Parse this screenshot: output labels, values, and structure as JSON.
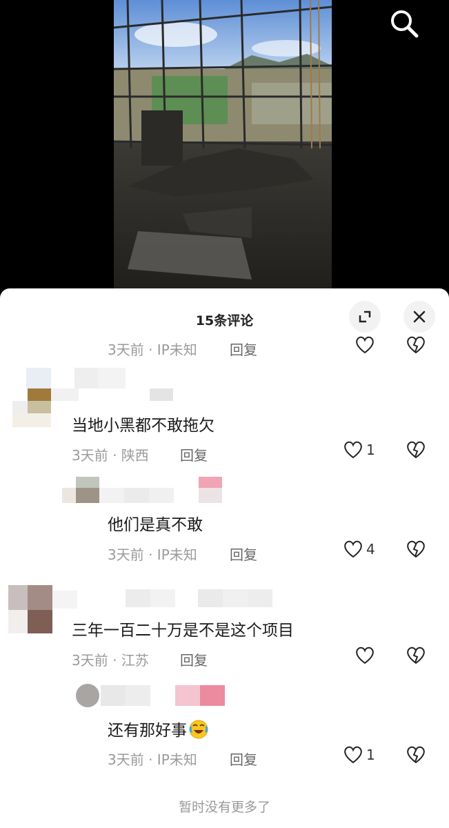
{
  "sheet": {
    "title": "15条评论",
    "footer": "暂时没有更多了"
  },
  "comments": [
    {
      "meta": "3天前 · IP未知",
      "reply": "回复",
      "likes": ""
    },
    {
      "text": "当地小黑都不敢拖欠",
      "meta": "3天前 · 陕西",
      "reply": "回复",
      "likes": "1"
    },
    {
      "text": "他们是真不敢",
      "meta": "3天前 · IP未知",
      "reply": "回复",
      "likes": "4"
    },
    {
      "text": "三年一百二十万是不是这个项目",
      "meta": "3天前 · 江苏",
      "reply": "回复",
      "likes": ""
    },
    {
      "text": "还有那好事",
      "emoji": "rolling-on-floor-laughing",
      "meta": "3天前 · IP未知",
      "reply": "回复",
      "likes": "1"
    }
  ],
  "icons": {
    "search": "search-icon",
    "expand": "expand-icon",
    "close": "close-icon",
    "like": "heart-outline-icon",
    "dislike": "broken-heart-icon"
  },
  "colors": {
    "background": "#000000",
    "sheet": "#ffffff",
    "meta": "#9a9a9a",
    "footer": "#999999"
  }
}
